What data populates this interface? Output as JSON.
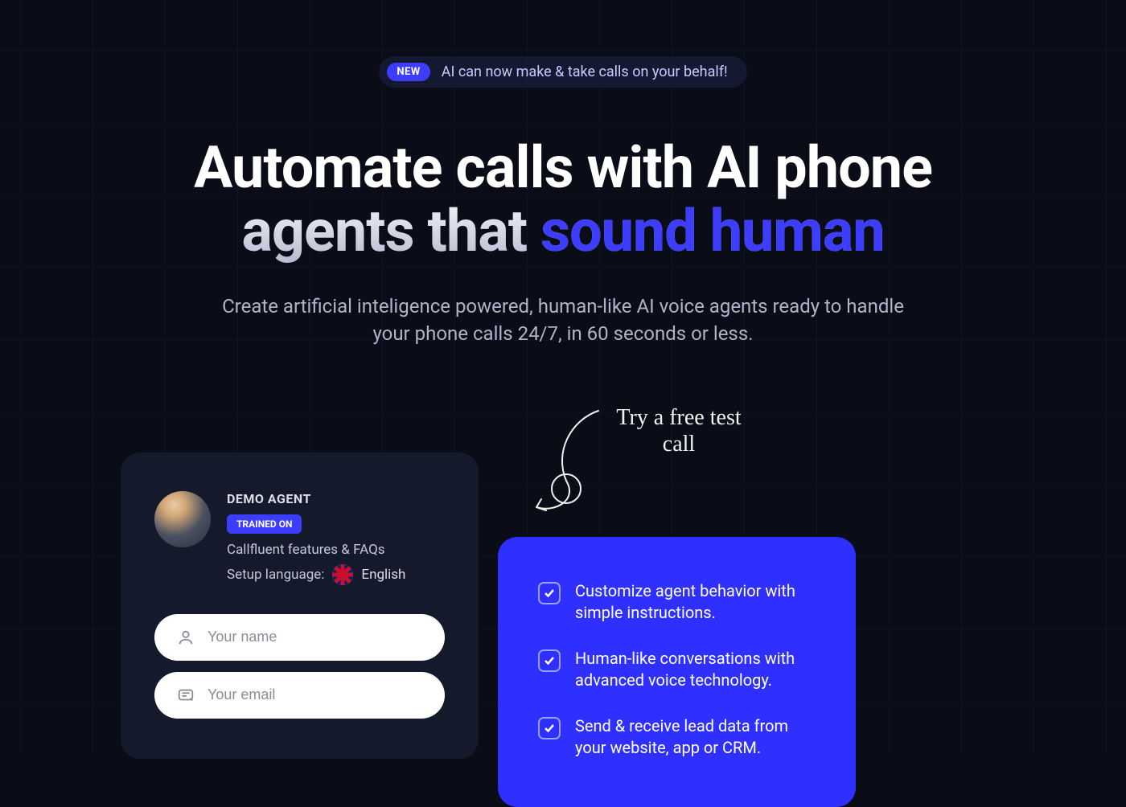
{
  "announce": {
    "badge": "NEW",
    "text": "AI can now make & take calls on your behalf!"
  },
  "hero": {
    "title_prefix": "Automate calls with AI phone agents that ",
    "title_accent": "sound human",
    "subtitle": "Create artificial inteligence powered, human-like AI voice agents ready to handle your phone calls 24/7, in 60 seconds or less."
  },
  "demo": {
    "label": "DEMO AGENT",
    "trained_badge": "TRAINED ON",
    "trained_text": "Callfluent features & FAQs",
    "setup_label": "Setup language:",
    "language": "English",
    "name_placeholder": "Your name",
    "email_placeholder": "Your email"
  },
  "cta_handwritten": "Try a free test call",
  "features": [
    "Customize agent behavior with simple instructions.",
    "Human-like conversations with advanced voice technology.",
    "Send & receive lead data from your website, app or CRM."
  ]
}
